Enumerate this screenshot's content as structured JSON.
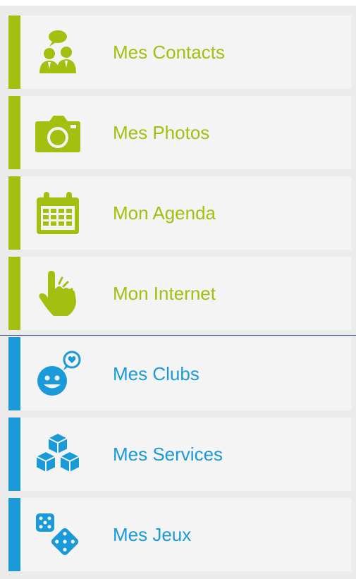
{
  "colors": {
    "green": "#a3c010",
    "blue": "#1a9ad8",
    "divider": "#3d5a99"
  },
  "menu": {
    "items": [
      {
        "label": "Mes Contacts",
        "icon": "contacts-icon",
        "group": "green"
      },
      {
        "label": "Mes Photos",
        "icon": "camera-icon",
        "group": "green"
      },
      {
        "label": "Mon Agenda",
        "icon": "calendar-icon",
        "group": "green"
      },
      {
        "label": "Mon Internet",
        "icon": "hand-pointer-icon",
        "group": "green"
      },
      {
        "label": "Mes Clubs",
        "icon": "smiley-heart-icon",
        "group": "blue"
      },
      {
        "label": "Mes Services",
        "icon": "cubes-icon",
        "group": "blue"
      },
      {
        "label": "Mes Jeux",
        "icon": "dice-icon",
        "group": "blue"
      }
    ]
  }
}
